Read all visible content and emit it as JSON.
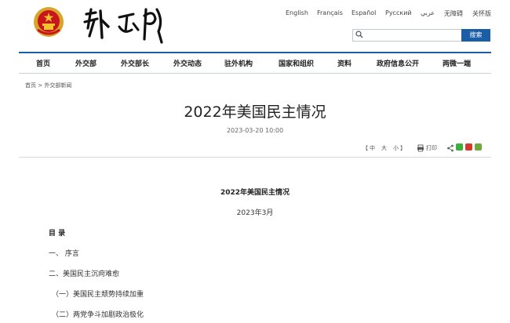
{
  "languages": [
    "English",
    "Français",
    "Español",
    "Русский",
    "عربي",
    "无障碍",
    "关怀版"
  ],
  "search": {
    "placeholder": "",
    "button": "搜索"
  },
  "nav": [
    "首页",
    "外交部",
    "外交部长",
    "外交动态",
    "驻外机构",
    "国家和组织",
    "资料",
    "政府信息公开",
    "两微一端"
  ],
  "breadcrumb": {
    "home": "首页",
    "sep": ">",
    "section": "外交部新闻"
  },
  "article": {
    "title": "2022年美国民主情况",
    "date": "2023-03-20 10:00",
    "font_size": {
      "open": "【",
      "large": "中",
      "medium": "大",
      "small": "小",
      "close": "】"
    },
    "print_label": "打印",
    "body_title": "2022年美国民主情况",
    "body_date": "2023年3月",
    "toc_heading": "目  录",
    "toc": [
      "一、 序言",
      "二、美国民主沉疴难愈",
      "（一）美国民主颓势持续加重",
      "（二）两党争斗加剧政治极化"
    ]
  },
  "colors": {
    "accent": "#1c5ea6",
    "emblem_red": "#c8161d",
    "emblem_gold": "#f2c230"
  }
}
